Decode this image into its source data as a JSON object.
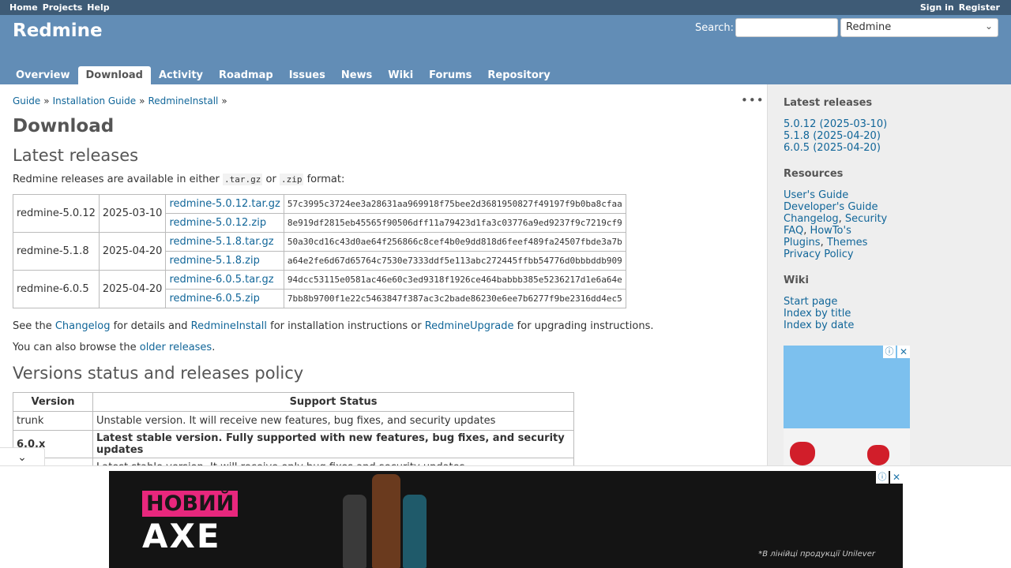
{
  "top_menu": {
    "left": [
      "Home",
      "Projects",
      "Help"
    ],
    "right": [
      "Sign in",
      "Register"
    ]
  },
  "header": {
    "title": "Redmine",
    "search_label": "Search:",
    "search_value": "",
    "project_select": "Redmine"
  },
  "tabs": [
    "Overview",
    "Download",
    "Activity",
    "Roadmap",
    "Issues",
    "News",
    "Wiki",
    "Forums",
    "Repository"
  ],
  "selected_tab": "Download",
  "breadcrumb": [
    "Guide",
    "Installation Guide",
    "RedmineInstall"
  ],
  "breadcrumb_sep": "»",
  "more_menu": "•••",
  "page_title": "Download",
  "latest_heading": "Latest releases",
  "intro": {
    "pre": "Redmine releases are available in either ",
    "tgz": ".tar.gz",
    "mid": " or ",
    "zip": ".zip",
    "post": " format:"
  },
  "releases": [
    {
      "version": "redmine-5.0.12",
      "date": "2025-03-10",
      "files": [
        {
          "name": "redmine-5.0.12.tar.gz",
          "hash": "57c3995c3724ee3a28631aa969918f75bee2d3681950827f49197f9b0ba8cfaa"
        },
        {
          "name": "redmine-5.0.12.zip",
          "hash": "8e919df2815eb45565f90506dff11a79423d1fa3c03776a9ed9237f9c7219cf9"
        }
      ]
    },
    {
      "version": "redmine-5.1.8",
      "date": "2025-04-20",
      "files": [
        {
          "name": "redmine-5.1.8.tar.gz",
          "hash": "50a30cd16c43d0ae64f256866c8cef4b0e9dd818d6feef489fa24507fbde3a7b"
        },
        {
          "name": "redmine-5.1.8.zip",
          "hash": "a64e2fe6d67d65764c7530e7333ddf5e113abc272445ffbb54776d0bbbddb909"
        }
      ]
    },
    {
      "version": "redmine-6.0.5",
      "date": "2025-04-20",
      "files": [
        {
          "name": "redmine-6.0.5.tar.gz",
          "hash": "94dcc53115e0581ac46e60c3ed9318f1926ce464babbb385e5236217d1e6a64e"
        },
        {
          "name": "redmine-6.0.5.zip",
          "hash": "7bb8b9700f1e22c5463847f387ac3c2bade86230e6ee7b6277f9be2316dd4ec5"
        }
      ]
    }
  ],
  "see_line": {
    "t1": "See the ",
    "l1": "Changelog",
    "t2": " for details and ",
    "l2": "RedmineInstall",
    "t3": " for installation instructions or ",
    "l3": "RedmineUpgrade",
    "t4": " for upgrading instructions."
  },
  "browse_line": {
    "t1": "You can also browse the ",
    "l1": "older releases",
    "t2": "."
  },
  "policy_heading": "Versions status and releases policy",
  "policy_table": {
    "headers": [
      "Version",
      "Support Status"
    ],
    "rows": [
      {
        "version": "trunk",
        "status": "Unstable version. It will receive new features, bug fixes, and security updates",
        "bold": false
      },
      {
        "version": "6.0.x",
        "status": "Latest stable version. Fully supported with new features, bug fixes, and security updates",
        "bold": true
      },
      {
        "version": "",
        "status": "Latest stable version. It will receive only bug fixes and security updates",
        "bold": false
      }
    ]
  },
  "sidebar": {
    "latest_heading": "Latest releases",
    "latest": [
      "5.0.12 (2025-03-10)",
      "5.1.8 (2025-04-20)",
      "6.0.5 (2025-04-20)"
    ],
    "resources_heading": "Resources",
    "resources": [
      {
        "links": [
          "User's Guide"
        ]
      },
      {
        "links": [
          "Developer's Guide"
        ]
      },
      {
        "links": [
          "Changelog",
          "Security"
        ]
      },
      {
        "links": [
          "FAQ",
          "HowTo's"
        ]
      },
      {
        "links": [
          "Plugins",
          "Themes"
        ]
      },
      {
        "links": [
          "Privacy Policy"
        ]
      }
    ],
    "wiki_heading": "Wiki",
    "wiki": [
      "Start page",
      "Index by title",
      "Index by date"
    ]
  },
  "ad_bottom": {
    "line1": "НОВИЙ",
    "line2": "AXE",
    "fine": "*В лінійці продукції Unilever"
  },
  "icons": {
    "ad_info": "ⓘ",
    "ad_close": "✕",
    "chevron": "⌄"
  },
  "colors": {
    "header_bg": "#628DB6",
    "top_bg": "#3E5B76",
    "link": "#169",
    "ad_pink": "#e8277d"
  }
}
